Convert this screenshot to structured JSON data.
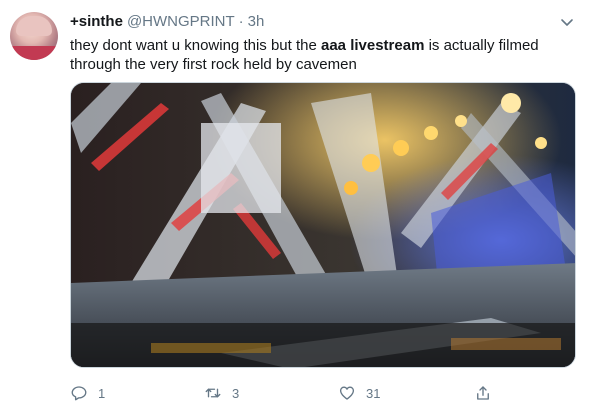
{
  "tweet": {
    "display_name": "+sinthe",
    "handle": "@HWNGPRINT",
    "separator": "·",
    "time": "3h",
    "text_before": "they dont want u knowing this but the ",
    "text_bold": "aaa livestream",
    "text_after": " is actually filmed through the very first rock held by cavemen"
  },
  "actions": {
    "reply_count": "1",
    "retweet_count": "3",
    "like_count": "31"
  },
  "icons": {
    "avatar": "avatar-image",
    "caret": "chevron-down-icon",
    "reply": "reply-icon",
    "retweet": "retweet-icon",
    "like": "heart-icon",
    "share": "share-icon"
  },
  "colors": {
    "text": "#14171a",
    "secondary": "#657786",
    "border": "#ccd6dd"
  }
}
